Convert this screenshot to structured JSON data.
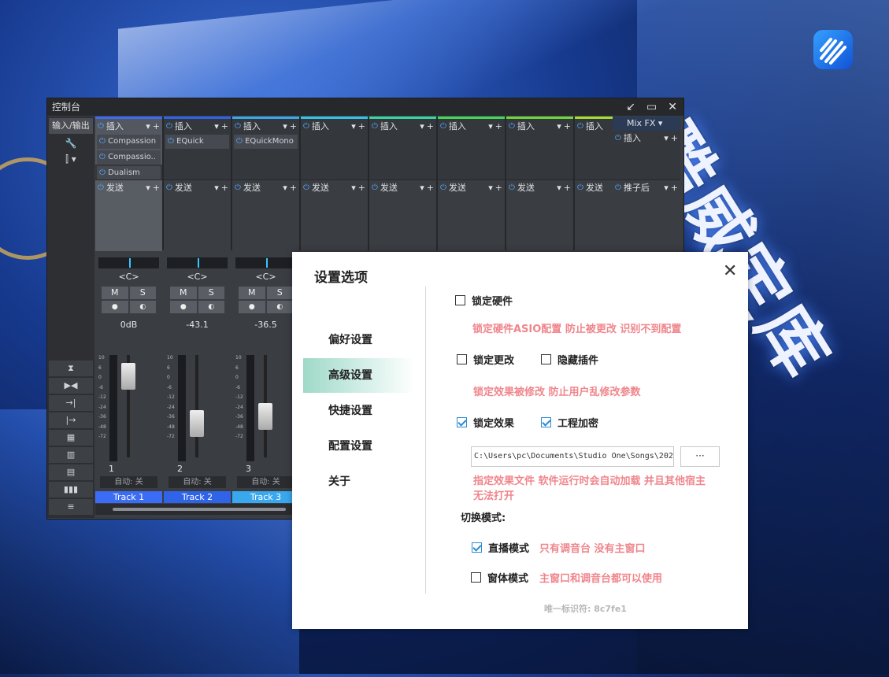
{
  "console": {
    "title": "控制台",
    "io_label": "输入/输出",
    "tracks": [
      {
        "insert": "插入",
        "send": "发送",
        "plugins": [
          "Compassion",
          "Compassio..",
          "Dualism"
        ],
        "pan": "<C>",
        "mute": "M",
        "solo": "S",
        "volume": "0dB",
        "number": "1",
        "auto": "自动: 关",
        "name": "Track 1",
        "color": "#3b6cf5"
      },
      {
        "insert": "插入",
        "send": "发送",
        "plugins": [
          "EQuick"
        ],
        "pan": "<C>",
        "mute": "M",
        "solo": "S",
        "volume": "-43.1",
        "number": "2",
        "auto": "自动: 关",
        "name": "Track 2",
        "color": "#2f63e8"
      },
      {
        "insert": "插入",
        "send": "发送",
        "plugins": [
          "EQuickMono"
        ],
        "pan": "<C>",
        "mute": "M",
        "solo": "S",
        "volume": "-36.5",
        "number": "3",
        "auto": "自动: 关",
        "name": "Track 3",
        "color": "#3aa8ee"
      },
      {
        "insert": "插入",
        "send": "发送",
        "plugins": [],
        "color": "#35c4e8"
      },
      {
        "insert": "插入",
        "send": "发送",
        "plugins": [],
        "color": "#39d6a0"
      },
      {
        "insert": "插入",
        "send": "发送",
        "plugins": [],
        "color": "#44d85a"
      },
      {
        "insert": "插入",
        "send": "发送",
        "plugins": [],
        "color": "#6ed83e"
      },
      {
        "insert": "插入",
        "send": "发送",
        "plugins": [],
        "color": "#a6dc34"
      }
    ],
    "mixfx": {
      "title": "Mix FX",
      "insert": "插入",
      "send": "推子后"
    },
    "meter_scale": [
      "10",
      "6",
      "0",
      "-6",
      "-12",
      "-24",
      "-36",
      "-48",
      "-72"
    ]
  },
  "dialog": {
    "title": "设置选项",
    "nav": [
      "偏好设置",
      "高级设置",
      "快捷设置",
      "配置设置",
      "关于"
    ],
    "active_nav": 1,
    "options": {
      "lock_hardware": {
        "label": "锁定硬件",
        "checked": false
      },
      "lock_hardware_hint": "锁定硬件ASIO配置 防止被更改 识别不到配置",
      "lock_changes": {
        "label": "锁定更改",
        "checked": false
      },
      "hide_plugins": {
        "label": "隐藏插件",
        "checked": false
      },
      "lock_changes_hint": "锁定效果被修改 防止用户乱修改参数",
      "lock_effects": {
        "label": "锁定效果",
        "checked": true
      },
      "encrypt_project": {
        "label": "工程加密",
        "checked": true
      },
      "effect_path": "C:\\Users\\pc\\Documents\\Studio One\\Songs\\202",
      "browse_label": "···",
      "effect_path_hint_1": "指定效果文件 软件运行时会自动加载 并且其他宿主",
      "effect_path_hint_2": "无法打开",
      "mode_label": "切换模式:",
      "live_mode": {
        "label": "直播模式",
        "checked": true
      },
      "live_mode_hint": "只有调音台 没有主窗口",
      "window_mode": {
        "label": "窗体模式",
        "checked": false
      },
      "window_mode_hint": "主窗口和调音台都可以使用"
    },
    "uid": "唯一标识符: 8c7fe1"
  },
  "background": {
    "deco_text": "酷威定库"
  }
}
